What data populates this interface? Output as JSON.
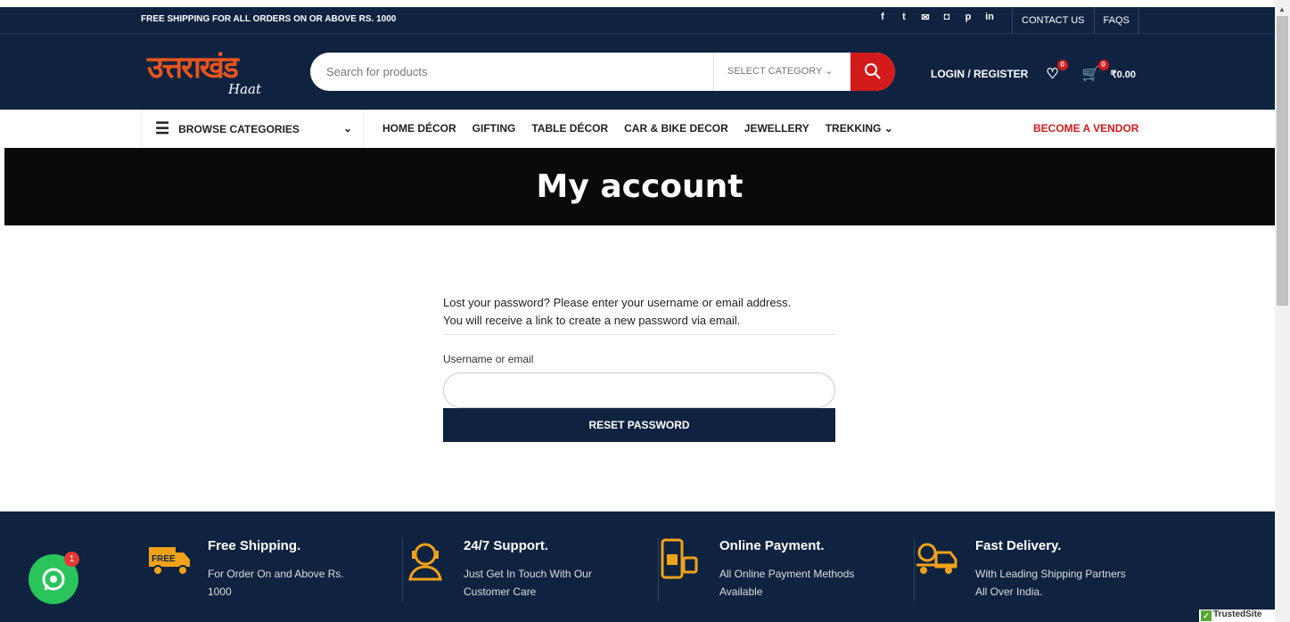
{
  "topbar": {
    "shipping_note": "FREE SHIPPING FOR ALL ORDERS ON OR ABOVE RS. 1000",
    "socials": [
      "f",
      "t",
      "✉",
      "◘",
      "p",
      "in"
    ],
    "links": [
      "CONTACT US",
      "FAQS"
    ]
  },
  "header": {
    "logo_main": "उत्तराखंड",
    "logo_sub": "Haat",
    "search_placeholder": "Search for products",
    "category_select": "SELECT CATEGORY ⌄",
    "login": "LOGIN / REGISTER",
    "wishlist_count": "0",
    "cart_count": "0",
    "cart_total": "₹0.00"
  },
  "nav": {
    "browse": "BROWSE CATEGORIES",
    "links": [
      "HOME DÉCOR",
      "GIFTING",
      "TABLE DÉCOR",
      "CAR & BIKE DECOR",
      "JEWELLERY",
      "TREKKING ⌄"
    ],
    "vendor": "BECOME A VENDOR"
  },
  "hero": {
    "title": "My account"
  },
  "form": {
    "line1": "Lost your password? Please enter your username or email address.",
    "line2": "You will receive a link to create a new password via email.",
    "label": "Username or email",
    "value": "",
    "button": "RESET PASSWORD"
  },
  "features": [
    {
      "title": "Free Shipping.",
      "desc": "For Order On and Above Rs. 1000",
      "icon": "truck-icon"
    },
    {
      "title": "24/7 Support.",
      "desc": "Just Get In Touch With Our Customer Care",
      "icon": "support-icon"
    },
    {
      "title": "Online Payment.",
      "desc": "All Online Payment Methods Available",
      "icon": "payment-icon"
    },
    {
      "title": "Fast Delivery.",
      "desc": "With Leading Shipping Partners All Over India.",
      "icon": "delivery-icon"
    }
  ],
  "whatsapp_badge": "1",
  "trusted": "TrustedSite",
  "colors": {
    "navy": "#0f2340",
    "accent": "#d41b1b",
    "logo": "#e8541e",
    "gold": "#f0a21a"
  }
}
